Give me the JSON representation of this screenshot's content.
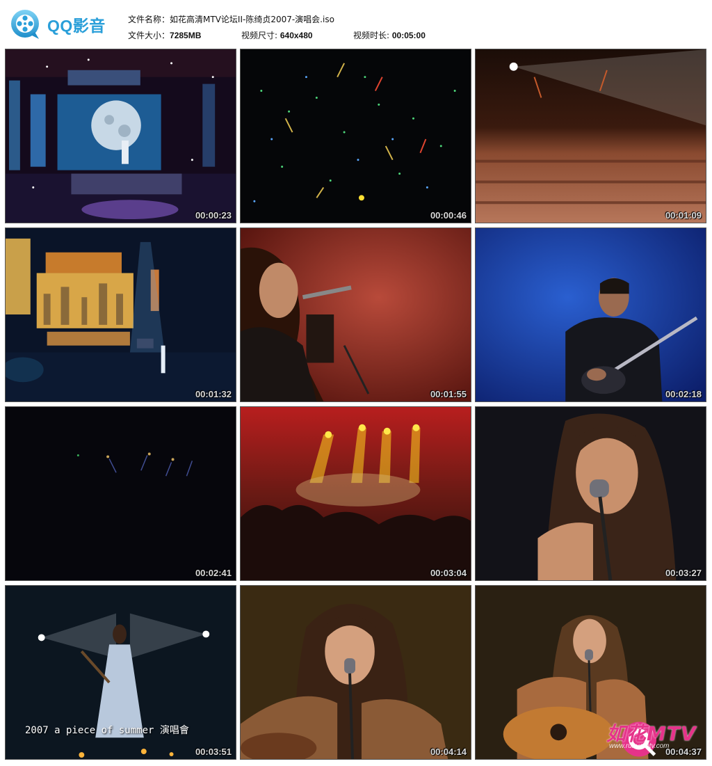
{
  "app": {
    "name": "QQ影音",
    "accent": "#2a9fd9"
  },
  "file_info": {
    "name_label": "文件名称：",
    "name_value": "如花高清MTV论坛II-陈绮贞2007-演唱会.iso",
    "size_label": "文件大小：",
    "size_value": "7285MB",
    "dims_label": "视频尺寸: ",
    "dims_value": "640x480",
    "duration_label": "视频时长: ",
    "duration_value": "00:05:00"
  },
  "thumbnails": [
    {
      "timestamp": "00:00:23",
      "scene": "moon-stage"
    },
    {
      "timestamp": "00:00:46",
      "scene": "glowsticks"
    },
    {
      "timestamp": "00:01:09",
      "scene": "crowd"
    },
    {
      "timestamp": "00:01:32",
      "scene": "city-stage"
    },
    {
      "timestamp": "00:01:55",
      "scene": "red-singer"
    },
    {
      "timestamp": "00:02:18",
      "scene": "blue-guitarist"
    },
    {
      "timestamp": "00:02:41",
      "scene": "dark-stage"
    },
    {
      "timestamp": "00:03:04",
      "scene": "spotlights"
    },
    {
      "timestamp": "00:03:27",
      "scene": "singer-closeup"
    },
    {
      "timestamp": "00:03:51",
      "scene": "white-dress",
      "caption": "2007 a piece of summer 演唱會"
    },
    {
      "timestamp": "00:04:14",
      "scene": "acoustic-singer"
    },
    {
      "timestamp": "00:04:37",
      "scene": "acoustic-wide"
    }
  ],
  "watermark": {
    "text": "如花MTV",
    "url": "www.ruhuamtv.com",
    "color": "#e6338a"
  }
}
